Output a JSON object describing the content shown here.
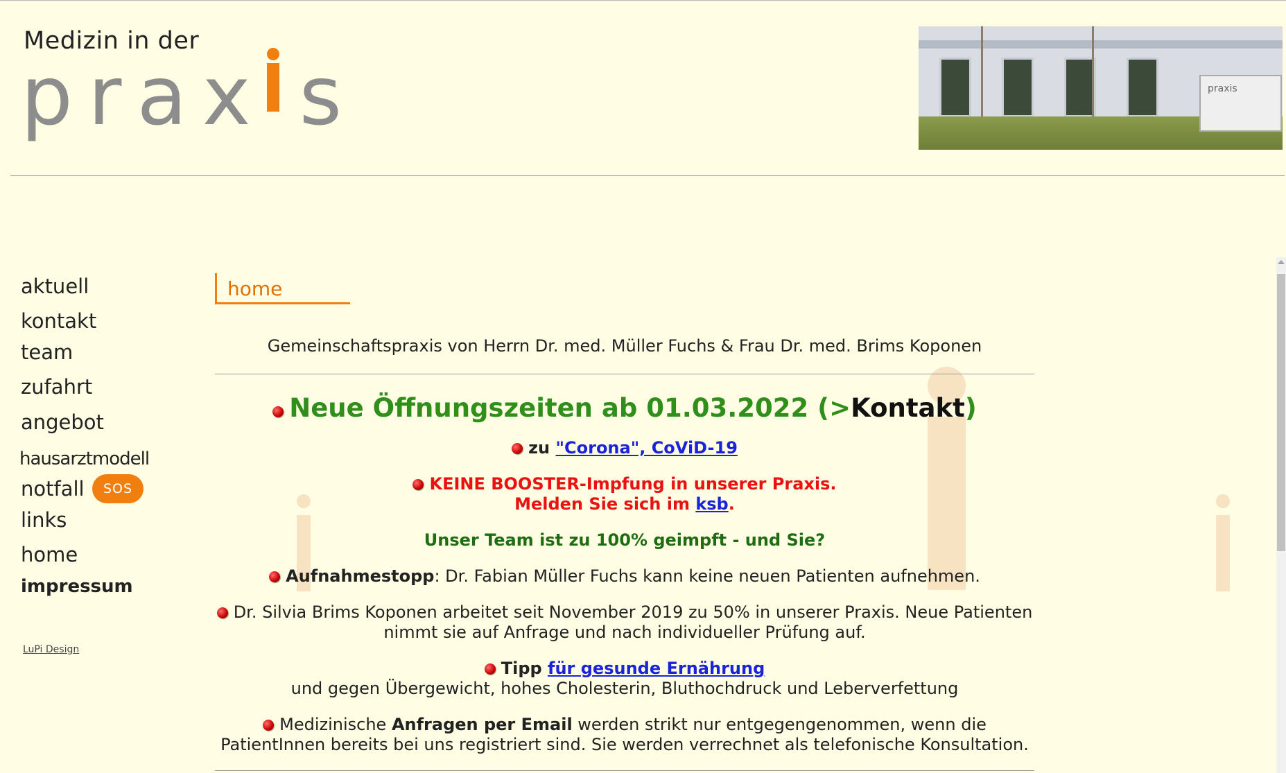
{
  "logo": {
    "small": "Medizin in der",
    "big": "pra x s",
    "alt_small": "praxis"
  },
  "photo": {
    "sign_text": "praxis"
  },
  "nav": {
    "items": [
      {
        "label": "aktuell"
      },
      {
        "label": "kontakt"
      },
      {
        "label": "team"
      },
      {
        "label": "zufahrt"
      },
      {
        "label": "angebot"
      },
      {
        "label": "hausarztmodell"
      },
      {
        "label": "notfall"
      },
      {
        "label": "links"
      },
      {
        "label": "home"
      },
      {
        "label": "impressum"
      }
    ],
    "sos_label": "SOS",
    "credit": "LuPi Design"
  },
  "section_title": "home",
  "content": {
    "intro": "Gemeinschaftspraxis von Herrn Dr. med. Müller Fuchs & Frau Dr. med. Brims Koponen",
    "headline_green": "Neue Öffnungszeiten ab 01.03.2022 (>",
    "headline_link": "Kontakt",
    "headline_close": ")",
    "corona_prefix": "zu ",
    "corona_link": "\"Corona\", CoViD-19",
    "booster_line1": "KEINE BOOSTER-Impfung in unserer Praxis.",
    "booster_line2_prefix": "Melden Sie sich im ",
    "booster_link": "ksb",
    "booster_line2_suffix": ".",
    "team_vaccinated": "Unser Team ist zu 100% geimpft - und Sie?",
    "stop_bold": "Aufnahmestopp",
    "stop_rest": ": Dr. Fabian Müller Fuchs kann keine neuen Patienten aufnehmen.",
    "silvia_line1": "Dr. Silvia Brims Koponen arbeitet seit November 2019 zu 50% in unserer Praxis. Neue Patienten",
    "silvia_line2": "nimmt sie auf Anfrage und nach individueller Prüfung auf.",
    "tipp_bold": "Tipp ",
    "tipp_link": "für gesunde Ernährung",
    "tipp_line2": "und gegen Übergewicht, hohes Cholesterin, Bluthochdruck und Leberverfettung",
    "email_prefix": "Medizinische ",
    "email_bold": "Anfragen per Email",
    "email_rest": " werden strikt nur entgegengenommen, wenn die",
    "email_line2": "PatientInnen bereits bei uns registriert sind. Sie werden verrechnet als telefonische Konsultation."
  },
  "colors": {
    "background": "#fffde3",
    "accent": "#f07f10",
    "headline": "#2f8f1a",
    "alert": "#ea1111",
    "link": "#1a23d8"
  }
}
